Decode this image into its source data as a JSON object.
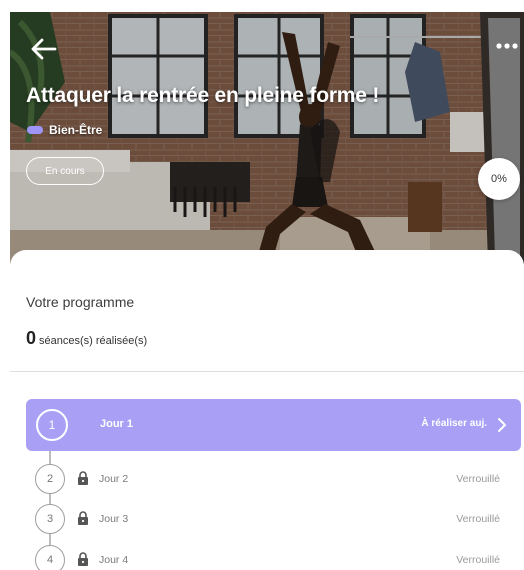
{
  "hero": {
    "title": "Attaquer la rentrée en pleine forme !",
    "category": "Bien-Être",
    "category_color": "#9f95f6",
    "status": "En cours",
    "progress": "0%",
    "back_icon": "arrow-left-icon",
    "more_icon": "more-horizontal-icon"
  },
  "program": {
    "section_title": "Votre programme",
    "sessions_count": "0",
    "sessions_label": "séances(s) réalisée(s)"
  },
  "days": [
    {
      "number": "1",
      "label": "Jour 1",
      "status": "À réaliser auj.",
      "locked": false
    },
    {
      "number": "2",
      "label": "Jour 2",
      "status": "Verrouillé",
      "locked": true
    },
    {
      "number": "3",
      "label": "Jour 3",
      "status": "Verrouillé",
      "locked": true
    },
    {
      "number": "4",
      "label": "Jour 4",
      "status": "Verrouillé",
      "locked": true
    }
  ],
  "colors": {
    "accent": "#a9a0f6",
    "locked_text": "#9a9a9a"
  }
}
